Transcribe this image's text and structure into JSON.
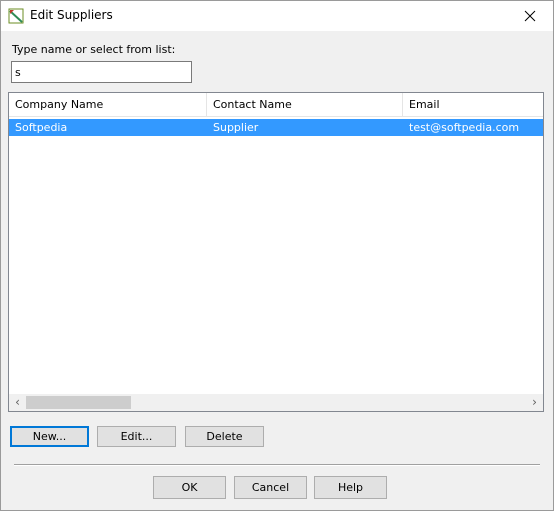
{
  "window": {
    "title": "Edit Suppliers"
  },
  "search": {
    "label": "Type name or select from list:",
    "value": "s"
  },
  "table": {
    "columns": [
      "Company Name",
      "Contact Name",
      "Email"
    ],
    "rows": [
      {
        "company": "Softpedia",
        "contact": "Supplier",
        "email": "test@softpedia.com"
      }
    ]
  },
  "actions": {
    "new": "New...",
    "edit": "Edit...",
    "delete": "Delete"
  },
  "dialog": {
    "ok": "OK",
    "cancel": "Cancel",
    "help": "Help"
  },
  "icons": {
    "app": "app-icon",
    "close": "close-icon",
    "scroll_left": "chevron-left-icon",
    "scroll_right": "chevron-right-icon"
  },
  "colors": {
    "selection": "#3399ff",
    "default_button_border": "#0078d7"
  }
}
